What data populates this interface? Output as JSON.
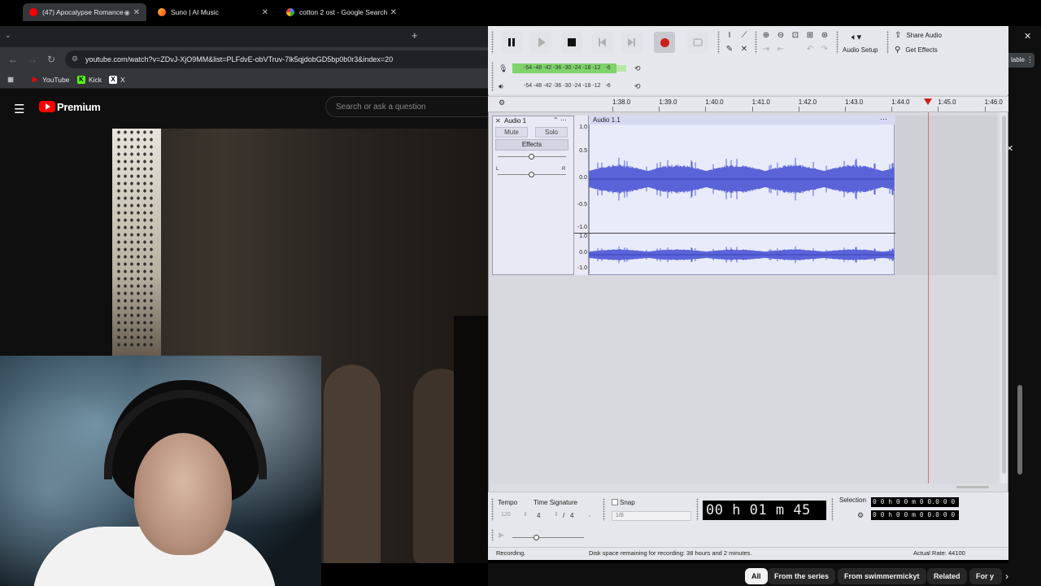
{
  "browser": {
    "tabs": [
      {
        "title": "(47) Apocalypse Romance",
        "favicon": "youtube-icon",
        "active": true
      },
      {
        "title": "Suno | AI Music",
        "favicon": "suno-icon",
        "active": false
      },
      {
        "title": "cotton 2 ost - Google Search",
        "favicon": "google-icon",
        "active": false
      }
    ],
    "url": "youtube.com/watch?v=ZDvJ-XjO9MM&list=PLFdvE-obVTruv-7lk5qjdobGD5bp0b0r3&index=20",
    "bookmarks": [
      {
        "label": "YouTube",
        "icon": "youtube-icon"
      },
      {
        "label": "Kick",
        "icon": "kick-icon"
      },
      {
        "label": "X",
        "icon": "x-icon"
      }
    ],
    "right_badge": "lable"
  },
  "youtube": {
    "brand": "Premium",
    "search_placeholder": "Search or ask a question",
    "chips": [
      "All",
      "From the series",
      "From swimmermickyt",
      "Related",
      "For y"
    ]
  },
  "audacity": {
    "audio_setup_label": "Audio Setup",
    "share_label": "Share Audio",
    "get_effects_label": "Get Effects",
    "rec_meter_ticks": "-54 -48 -42 -36 -30 -24 -18 -12   -6",
    "play_meter_ticks": "-54 -48 -42 -36 -30 -24 -18 -12   -6",
    "ruler_ticks": [
      "1:38.0",
      "1:39.0",
      "1:40.0",
      "1:41.0",
      "1:42.0",
      "1:43.0",
      "1:44.0",
      "1:45.0",
      "1:46.0"
    ],
    "track": {
      "name": "Audio 1",
      "clip_name": "Audio 1.1",
      "mute": "Mute",
      "solo": "Solo",
      "effects": "Effects",
      "left": "L",
      "right": "R",
      "vruler_top": [
        "1.0",
        "0.5",
        "0.0",
        "-0.5",
        "-1.0"
      ],
      "vruler_bottom": [
        "1.0",
        "0.0",
        "-1.0"
      ]
    },
    "bottom": {
      "tempo_label": "Tempo",
      "tempo_value": "120",
      "time_sig_label": "Time Signature",
      "time_sig_num": "4",
      "time_sig_den": "4",
      "snap_label": "Snap",
      "snap_value": "1/8",
      "timer": "00 h 01 m 45 s",
      "selection_label": "Selection",
      "sel_start": "0 0 h 0 0 m 0 0.0 0 0 s",
      "sel_end": "0 0 h 0 0 m 0 0.0 0 0 s"
    },
    "status": {
      "state": "Recording.",
      "disk": "Disk space remaining for recording: 38 hours and 2 minutes.",
      "rate": "Actual Rate: 44100"
    },
    "colors": {
      "wave": "#5a63d8",
      "record": "#cc1f1f",
      "meter": "#7ed36a"
    }
  }
}
